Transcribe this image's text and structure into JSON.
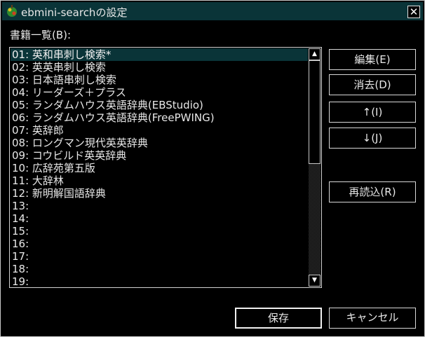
{
  "window": {
    "title": "ebmini-searchの設定"
  },
  "list": {
    "label": "書籍一覧(B):",
    "items": [
      "01: 英和串刺し検索*",
      "02: 英英串刺し検索",
      "03: 日本語串刺し検索",
      "04: リーダーズ＋プラス",
      "05: ランダムハウス英語辞典(EBStudio)",
      "06: ランダムハウス英語辞典(FreePWING)",
      "07: 英辞郎",
      "08: ロングマン現代英英辞典",
      "09: コウビルド英英辞典",
      "10: 広辞苑第五版",
      "11: 大辞林",
      "12: 新明解国語辞典",
      "13:",
      "14:",
      "15:",
      "16:",
      "17:",
      "18:",
      "19:"
    ],
    "selected_index": 0
  },
  "buttons": {
    "edit": "編集(E)",
    "delete": "消去(D)",
    "move_up": "↑(I)",
    "move_down": "↓(J)",
    "reload": "再読込(R)",
    "save": "保存",
    "cancel": "キャンセル"
  },
  "icons": {
    "app": "app-icon",
    "close": "close-icon",
    "scroll_up": "scroll-up-arrow-icon",
    "scroll_down": "scroll-down-arrow-icon"
  },
  "colors": {
    "background": "#000000",
    "titlebar": "#0a3438",
    "selection": "#0a3438",
    "text": "#e8e8e8",
    "border": "#d0d0d0"
  }
}
